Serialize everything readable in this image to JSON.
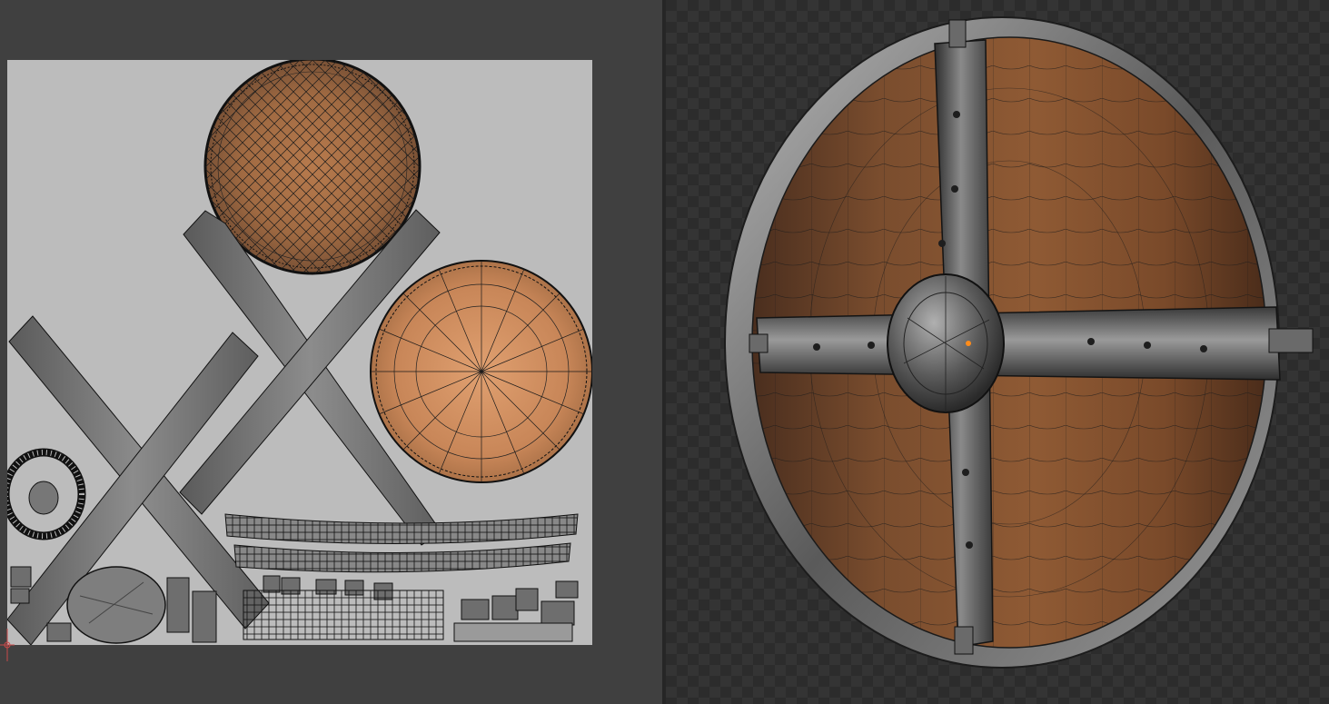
{
  "editors": {
    "uv_editor": {
      "icon": "uv-origin-gizmo-icon"
    },
    "viewport": {
      "object": "round-shield-mesh",
      "icon": "object-origin-icon"
    }
  },
  "colors": {
    "uv_background": "#bcbcbc",
    "wood": "#8a5a34",
    "wood_light": "#c98a5a",
    "metal": "#7a7a7a",
    "metal_dark": "#3c3c3c",
    "wire": "#111111",
    "origin": "#ff8c1a"
  }
}
